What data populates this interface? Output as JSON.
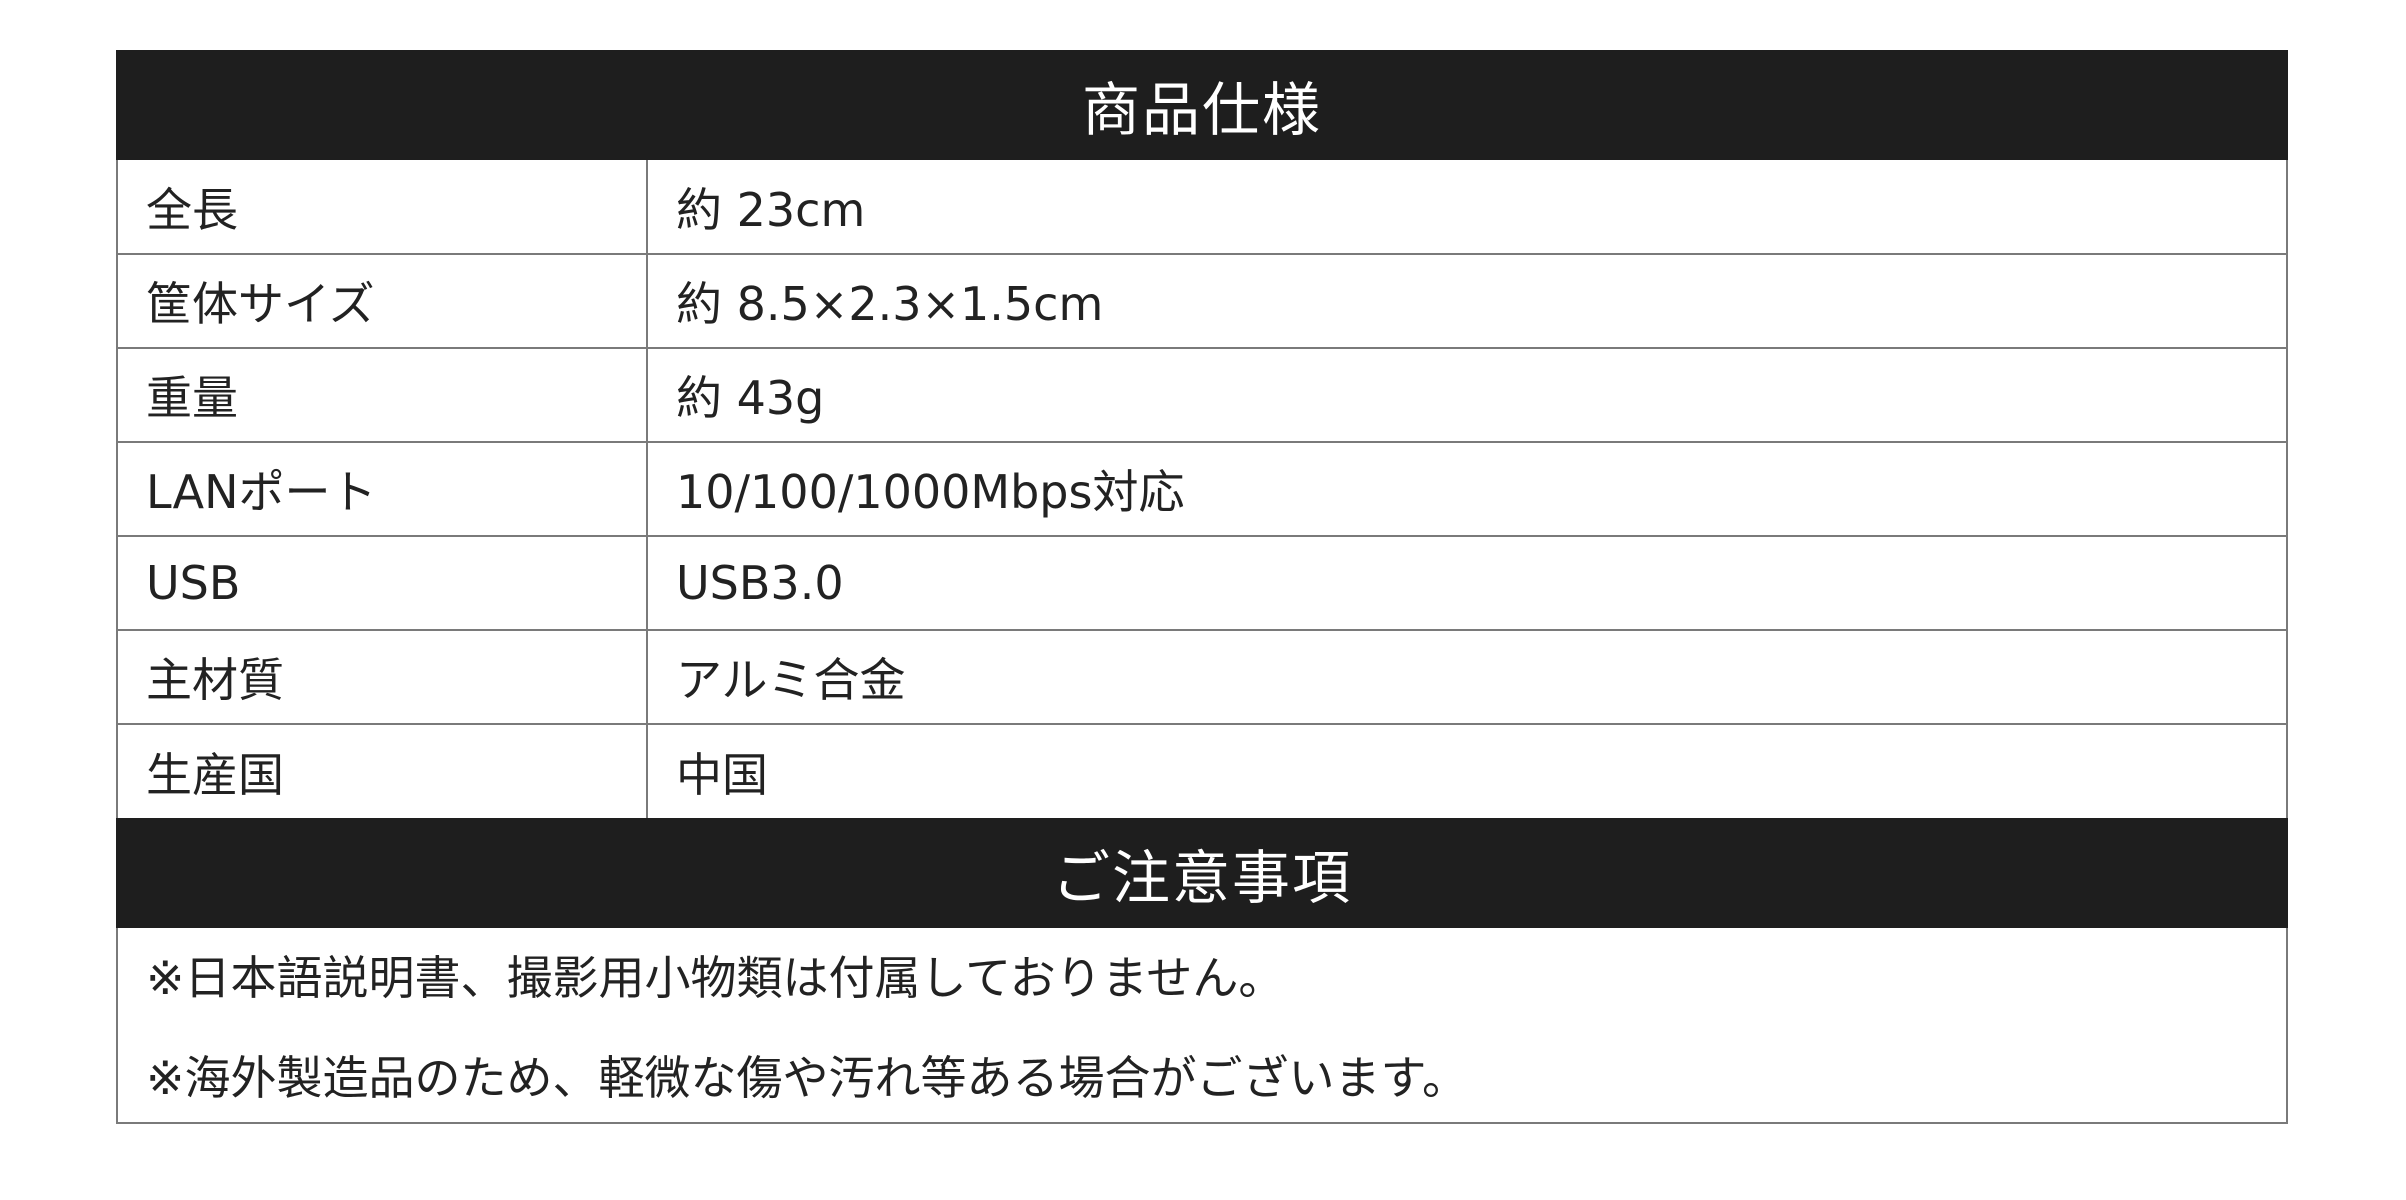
{
  "spec_section": {
    "title": "商品仕様",
    "rows": [
      {
        "label": "全長",
        "value": "約 23cm"
      },
      {
        "label": "筐体サイズ",
        "value": "約 8.5×2.3×1.5cm"
      },
      {
        "label": "重量",
        "value": "約 43g"
      },
      {
        "label": "LANポート",
        "value": "10/100/1000Mbps対応"
      },
      {
        "label": "USB",
        "value": "USB3.0"
      },
      {
        "label": "主材質",
        "value": "アルミ合金"
      },
      {
        "label": "生産国",
        "value": "中国"
      }
    ]
  },
  "notes_section": {
    "title": "ご注意事項",
    "notes": [
      "※日本語説明書、撮影用小物類は付属しておりません。",
      "※海外製造品のため、軽微な傷や汚れ等ある場合がございます。"
    ]
  },
  "colors": {
    "header_bg": "#1e1e1e",
    "header_text": "#ffffff",
    "border": "#7a7a7a",
    "text": "#222222"
  }
}
